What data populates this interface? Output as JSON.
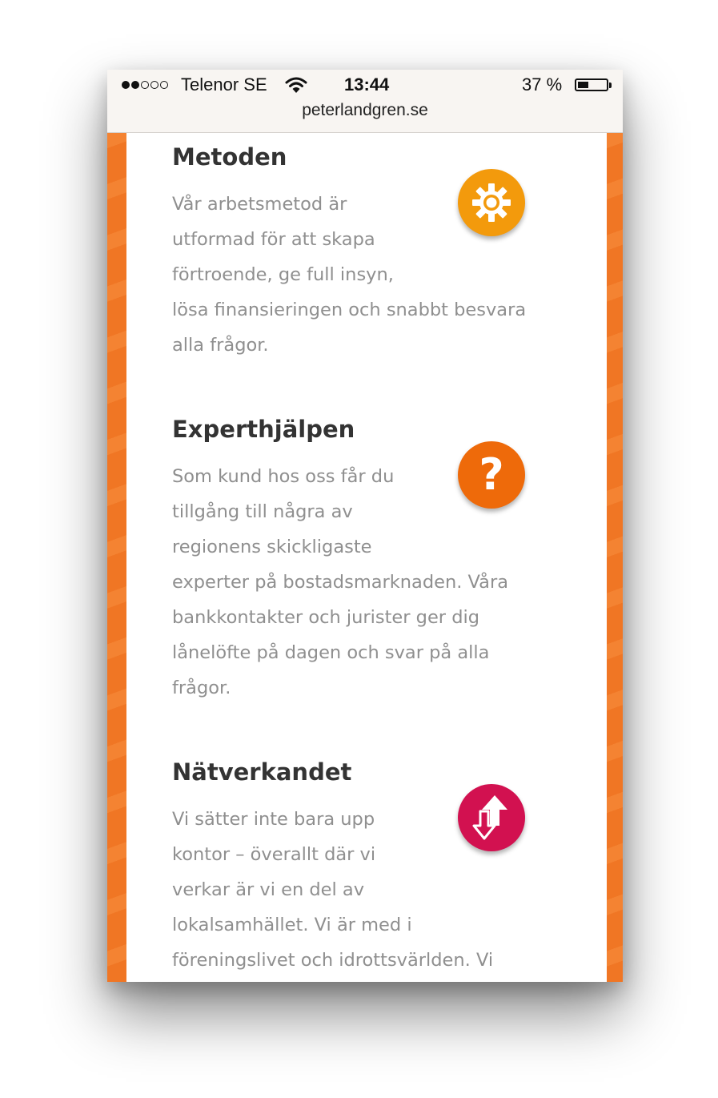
{
  "status_bar": {
    "carrier": "Telenor SE",
    "time": "13:44",
    "battery": "37 %",
    "battery_level": 0.37,
    "signal_bars_filled": 2,
    "signal_bars_total": 5,
    "url": "peterlandgren.se"
  },
  "colors": {
    "side_accent": "#f07624",
    "gear_icon_bg": "#f39a0c",
    "question_icon_bg": "#ee6a0a",
    "arrows_icon_bg": "#d21150",
    "heading": "#333333",
    "body_text": "#8f8f8f"
  },
  "sections": [
    {
      "title": "Metoden",
      "icon": "gear-icon",
      "text": "Vår arbetsmetod är\nutformad för att skapa\nförtroende, ge full insyn,\nlösa finansieringen och snabbt besvara\nalla frågor."
    },
    {
      "title": "Experthjälpen",
      "icon": "question-mark-icon",
      "icon_glyph": "?",
      "text": "Som kund hos oss får du\ntillgång till några av\nregionens skickligaste\nexperter på bostadsmarknaden. Våra\nbankkontakter och jurister ger dig\nlånelöfte på dagen och svar på alla\nfrågor."
    },
    {
      "title": "Nätverkandet",
      "icon": "up-down-arrows-icon",
      "text": "Vi sätter inte bara upp\nkontor – överallt där vi\nverkar är vi en del av\nlokalsamhället. Vi är med i\nföreningslivet och idrottsvärlden. Vi"
    }
  ]
}
